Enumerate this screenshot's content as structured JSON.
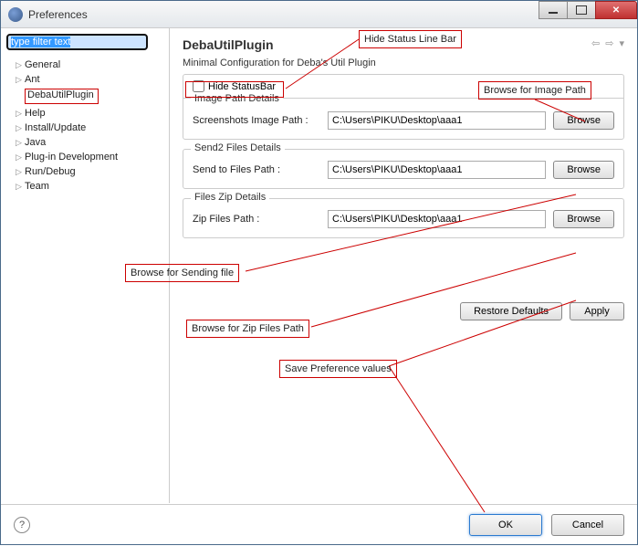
{
  "window": {
    "title": "Preferences"
  },
  "sidebar": {
    "filter_placeholder": "type filter text",
    "items": [
      {
        "label": "General",
        "expandable": true
      },
      {
        "label": "Ant",
        "expandable": true
      },
      {
        "label": "DebaUtilPlugin",
        "expandable": false,
        "selected": true
      },
      {
        "label": "Help",
        "expandable": true
      },
      {
        "label": "Install/Update",
        "expandable": true
      },
      {
        "label": "Java",
        "expandable": true
      },
      {
        "label": "Plug-in Development",
        "expandable": true
      },
      {
        "label": "Run/Debug",
        "expandable": true
      },
      {
        "label": "Team",
        "expandable": true
      }
    ]
  },
  "content": {
    "heading": "DebaUtilPlugin",
    "subtitle": "Minimal Configuration for Deba's Util Plugin",
    "hide_statusbar_label": "Hide StatusBar",
    "group1": {
      "title": "Image Path Details",
      "label": "Screenshots Image Path :",
      "value": "C:\\Users\\PIKU\\Desktop\\aaa1",
      "browse": "Browse"
    },
    "group2": {
      "title": "Send2 Files Details",
      "label": "Send to Files Path :",
      "value": "C:\\Users\\PIKU\\Desktop\\aaa1",
      "browse": "Browse"
    },
    "group3": {
      "title": "Files Zip Details",
      "label": "Zip Files Path :",
      "value": "C:\\Users\\PIKU\\Desktop\\aaa1",
      "browse": "Browse"
    },
    "restore": "Restore Defaults",
    "apply": "Apply"
  },
  "footer": {
    "ok": "OK",
    "cancel": "Cancel"
  },
  "callouts": {
    "hide_status": "Hide Status Line Bar",
    "browse_image": "Browse for Image Path",
    "browse_send": "Browse for Sending file",
    "browse_zip": "Browse for Zip Files Path",
    "save_pref": "Save Preference values"
  }
}
